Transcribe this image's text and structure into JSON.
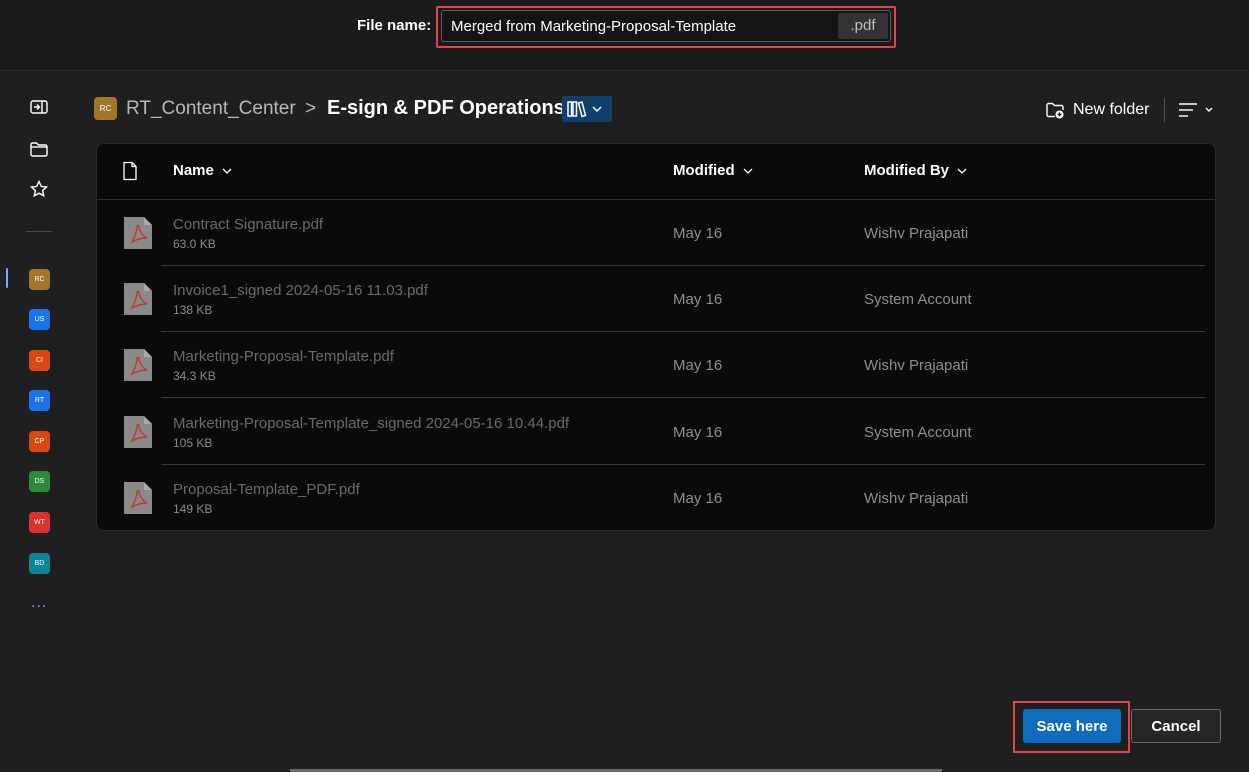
{
  "file_name": {
    "label": "File name:",
    "value": "Merged from Marketing-Proposal-Template",
    "extension": ".pdf"
  },
  "rail": {
    "sites": [
      {
        "initials": "RC",
        "color": "#a07628"
      },
      {
        "initials": "US",
        "color": "#1a73e8"
      },
      {
        "initials": "CI",
        "color": "#d9480f"
      },
      {
        "initials": "RT",
        "color": "#1a73e8"
      },
      {
        "initials": "CP",
        "color": "#d9480f"
      },
      {
        "initials": "DS",
        "color": "#2b8a3e"
      },
      {
        "initials": "WT",
        "color": "#e03131"
      },
      {
        "initials": "BD",
        "color": "#0c8599"
      }
    ],
    "more": "..."
  },
  "breadcrumb": {
    "site_initials": "RC",
    "site": "RT_Content_Center",
    "separator": ">",
    "current": "E-sign & PDF Operations"
  },
  "toolbar": {
    "new_folder": "New folder"
  },
  "table": {
    "columns": {
      "name": "Name",
      "modified": "Modified",
      "modified_by": "Modified By"
    },
    "rows": [
      {
        "name": "Contract Signature.pdf",
        "size": "63.0 KB",
        "modified": "May 16",
        "modified_by": "Wishv Prajapati"
      },
      {
        "name": "Invoice1_signed 2024-05-16 11.03.pdf",
        "size": "138 KB",
        "modified": "May 16",
        "modified_by": "System Account"
      },
      {
        "name": "Marketing-Proposal-Template.pdf",
        "size": "34.3 KB",
        "modified": "May 16",
        "modified_by": "Wishv Prajapati"
      },
      {
        "name": "Marketing-Proposal-Template_signed 2024-05-16 10.44.pdf",
        "size": "105 KB",
        "modified": "May 16",
        "modified_by": "System Account"
      },
      {
        "name": "Proposal-Template_PDF.pdf",
        "size": "149 KB",
        "modified": "May 16",
        "modified_by": "Wishv Prajapati"
      }
    ]
  },
  "footer": {
    "save_label": "Save here",
    "cancel_label": "Cancel"
  },
  "colors": {
    "accent": "#0f6cbd",
    "highlight": "#e0454d",
    "pdf_red": "#c0392b"
  }
}
